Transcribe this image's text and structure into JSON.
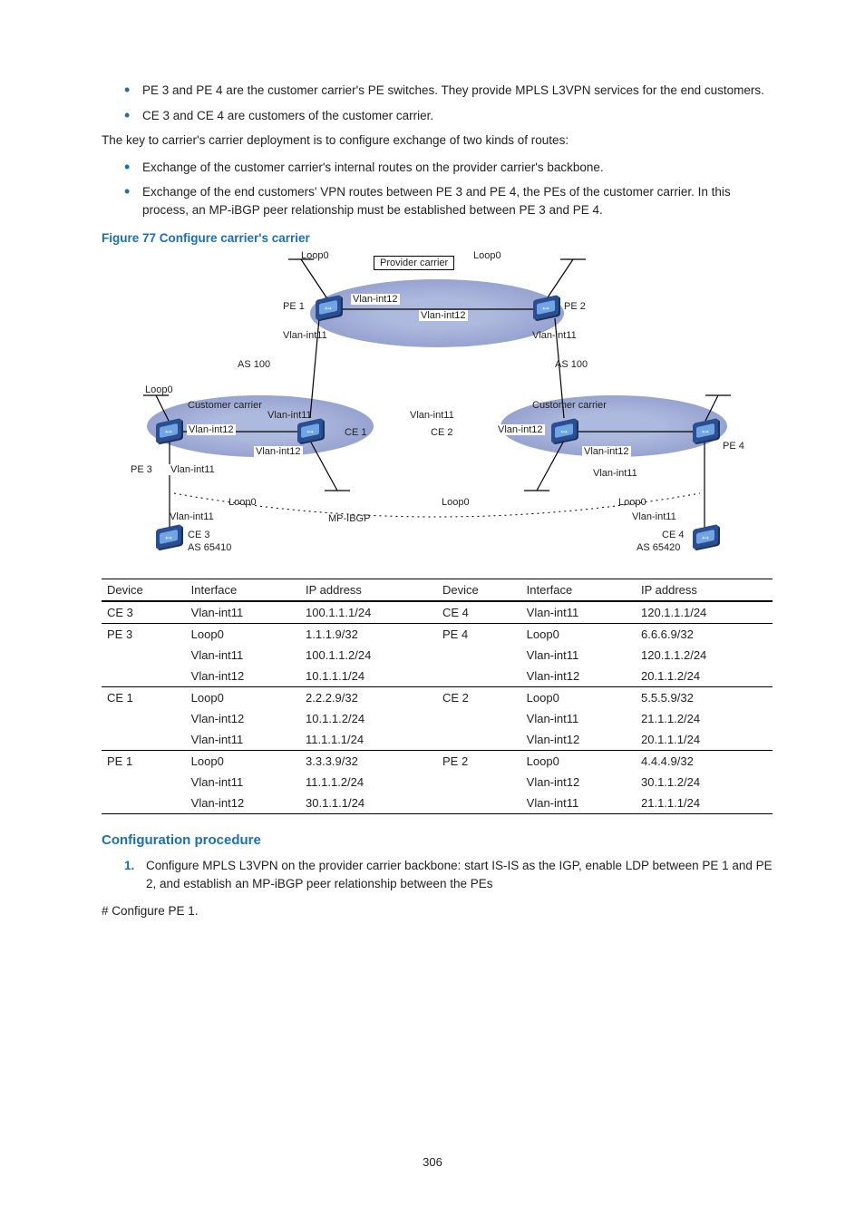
{
  "bullets_top": [
    "PE 3 and PE 4 are the customer carrier's PE switches. They provide MPLS L3VPN services for the end customers.",
    "CE 3 and CE 4 are customers of the customer carrier."
  ],
  "para_key": "The key to carrier's carrier deployment is to configure exchange of two kinds of routes:",
  "bullets_routes": [
    "Exchange of the customer carrier's internal routes on the provider carrier's backbone.",
    "Exchange of the end customers' VPN routes between PE 3 and PE 4, the PEs of the customer carrier. In this process, an MP-iBGP peer relationship must be established between PE 3 and PE 4."
  ],
  "figure_caption": "Figure 77 Configure carrier's carrier",
  "figure": {
    "provider_carrier": "Provider carrier",
    "customer_carrier": "Customer carrier",
    "loop0": "Loop0",
    "vlan11": "Vlan-int11",
    "vlan12": "Vlan-int12",
    "pe1": "PE 1",
    "pe2": "PE 2",
    "pe3": "PE 3",
    "pe4": "PE 4",
    "ce1": "CE 1",
    "ce2": "CE 2",
    "ce3": "CE 3",
    "ce4": "CE 4",
    "as100": "AS 100",
    "mp_ibgp": "MP-IBGP",
    "as65410": "AS 65410",
    "as65420": "AS 65420"
  },
  "table_headers": [
    "Device",
    "Interface",
    "IP address",
    "Device",
    "Interface",
    "IP address"
  ],
  "table_rows": [
    {
      "d1": "CE 3",
      "if1": "Vlan-int11",
      "ip1": "100.1.1.1/24",
      "d2": "CE 4",
      "if2": "Vlan-int11",
      "ip2": "120.1.1.1/24",
      "border": true
    },
    {
      "d1": "PE 3",
      "if1": "Loop0",
      "ip1": "1.1.1.9/32",
      "d2": "PE 4",
      "if2": "Loop0",
      "ip2": "6.6.6.9/32",
      "border": false
    },
    {
      "d1": "",
      "if1": "Vlan-int11",
      "ip1": "100.1.1.2/24",
      "d2": "",
      "if2": "Vlan-int11",
      "ip2": "120.1.1.2/24",
      "border": false
    },
    {
      "d1": "",
      "if1": "Vlan-int12",
      "ip1": "10.1.1.1/24",
      "d2": "",
      "if2": "Vlan-int12",
      "ip2": "20.1.1.2/24",
      "border": true
    },
    {
      "d1": "CE 1",
      "if1": "Loop0",
      "ip1": "2.2.2.9/32",
      "d2": "CE 2",
      "if2": "Loop0",
      "ip2": "5.5.5.9/32",
      "border": false
    },
    {
      "d1": "",
      "if1": "Vlan-int12",
      "ip1": "10.1.1.2/24",
      "d2": "",
      "if2": "Vlan-int11",
      "ip2": "21.1.1.2/24",
      "border": false
    },
    {
      "d1": "",
      "if1": "Vlan-int11",
      "ip1": "11.1.1.1/24",
      "d2": "",
      "if2": "Vlan-int12",
      "ip2": "20.1.1.1/24",
      "border": true
    },
    {
      "d1": "PE 1",
      "if1": "Loop0",
      "ip1": "3.3.3.9/32",
      "d2": "PE 2",
      "if2": "Loop0",
      "ip2": "4.4.4.9/32",
      "border": false
    },
    {
      "d1": "",
      "if1": "Vlan-int11",
      "ip1": "11.1.1.2/24",
      "d2": "",
      "if2": "Vlan-int12",
      "ip2": "30.1.1.2/24",
      "border": false
    },
    {
      "d1": "",
      "if1": "Vlan-int12",
      "ip1": "30.1.1.1/24",
      "d2": "",
      "if2": "Vlan-int11",
      "ip2": "21.1.1.1/24",
      "border": true
    }
  ],
  "section_heading": "Configuration procedure",
  "step1": "Configure MPLS L3VPN on the provider carrier backbone: start IS-IS as the IGP, enable LDP between PE 1 and PE 2, and establish an MP-iBGP peer relationship between the PEs",
  "config_pe1": "# Configure PE 1.",
  "page_number": "306"
}
